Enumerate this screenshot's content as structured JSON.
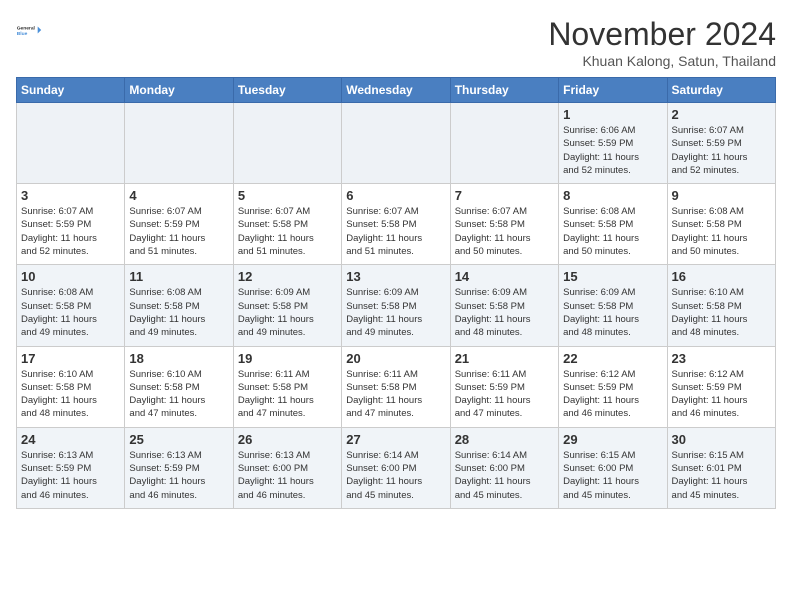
{
  "logo": {
    "line1": "General",
    "line2": "Blue"
  },
  "title": "November 2024",
  "location": "Khuan Kalong, Satun, Thailand",
  "weekdays": [
    "Sunday",
    "Monday",
    "Tuesday",
    "Wednesday",
    "Thursday",
    "Friday",
    "Saturday"
  ],
  "weeks": [
    [
      {
        "day": "",
        "info": ""
      },
      {
        "day": "",
        "info": ""
      },
      {
        "day": "",
        "info": ""
      },
      {
        "day": "",
        "info": ""
      },
      {
        "day": "",
        "info": ""
      },
      {
        "day": "1",
        "info": "Sunrise: 6:06 AM\nSunset: 5:59 PM\nDaylight: 11 hours\nand 52 minutes."
      },
      {
        "day": "2",
        "info": "Sunrise: 6:07 AM\nSunset: 5:59 PM\nDaylight: 11 hours\nand 52 minutes."
      }
    ],
    [
      {
        "day": "3",
        "info": "Sunrise: 6:07 AM\nSunset: 5:59 PM\nDaylight: 11 hours\nand 52 minutes."
      },
      {
        "day": "4",
        "info": "Sunrise: 6:07 AM\nSunset: 5:59 PM\nDaylight: 11 hours\nand 51 minutes."
      },
      {
        "day": "5",
        "info": "Sunrise: 6:07 AM\nSunset: 5:58 PM\nDaylight: 11 hours\nand 51 minutes."
      },
      {
        "day": "6",
        "info": "Sunrise: 6:07 AM\nSunset: 5:58 PM\nDaylight: 11 hours\nand 51 minutes."
      },
      {
        "day": "7",
        "info": "Sunrise: 6:07 AM\nSunset: 5:58 PM\nDaylight: 11 hours\nand 50 minutes."
      },
      {
        "day": "8",
        "info": "Sunrise: 6:08 AM\nSunset: 5:58 PM\nDaylight: 11 hours\nand 50 minutes."
      },
      {
        "day": "9",
        "info": "Sunrise: 6:08 AM\nSunset: 5:58 PM\nDaylight: 11 hours\nand 50 minutes."
      }
    ],
    [
      {
        "day": "10",
        "info": "Sunrise: 6:08 AM\nSunset: 5:58 PM\nDaylight: 11 hours\nand 49 minutes."
      },
      {
        "day": "11",
        "info": "Sunrise: 6:08 AM\nSunset: 5:58 PM\nDaylight: 11 hours\nand 49 minutes."
      },
      {
        "day": "12",
        "info": "Sunrise: 6:09 AM\nSunset: 5:58 PM\nDaylight: 11 hours\nand 49 minutes."
      },
      {
        "day": "13",
        "info": "Sunrise: 6:09 AM\nSunset: 5:58 PM\nDaylight: 11 hours\nand 49 minutes."
      },
      {
        "day": "14",
        "info": "Sunrise: 6:09 AM\nSunset: 5:58 PM\nDaylight: 11 hours\nand 48 minutes."
      },
      {
        "day": "15",
        "info": "Sunrise: 6:09 AM\nSunset: 5:58 PM\nDaylight: 11 hours\nand 48 minutes."
      },
      {
        "day": "16",
        "info": "Sunrise: 6:10 AM\nSunset: 5:58 PM\nDaylight: 11 hours\nand 48 minutes."
      }
    ],
    [
      {
        "day": "17",
        "info": "Sunrise: 6:10 AM\nSunset: 5:58 PM\nDaylight: 11 hours\nand 48 minutes."
      },
      {
        "day": "18",
        "info": "Sunrise: 6:10 AM\nSunset: 5:58 PM\nDaylight: 11 hours\nand 47 minutes."
      },
      {
        "day": "19",
        "info": "Sunrise: 6:11 AM\nSunset: 5:58 PM\nDaylight: 11 hours\nand 47 minutes."
      },
      {
        "day": "20",
        "info": "Sunrise: 6:11 AM\nSunset: 5:58 PM\nDaylight: 11 hours\nand 47 minutes."
      },
      {
        "day": "21",
        "info": "Sunrise: 6:11 AM\nSunset: 5:59 PM\nDaylight: 11 hours\nand 47 minutes."
      },
      {
        "day": "22",
        "info": "Sunrise: 6:12 AM\nSunset: 5:59 PM\nDaylight: 11 hours\nand 46 minutes."
      },
      {
        "day": "23",
        "info": "Sunrise: 6:12 AM\nSunset: 5:59 PM\nDaylight: 11 hours\nand 46 minutes."
      }
    ],
    [
      {
        "day": "24",
        "info": "Sunrise: 6:13 AM\nSunset: 5:59 PM\nDaylight: 11 hours\nand 46 minutes."
      },
      {
        "day": "25",
        "info": "Sunrise: 6:13 AM\nSunset: 5:59 PM\nDaylight: 11 hours\nand 46 minutes."
      },
      {
        "day": "26",
        "info": "Sunrise: 6:13 AM\nSunset: 6:00 PM\nDaylight: 11 hours\nand 46 minutes."
      },
      {
        "day": "27",
        "info": "Sunrise: 6:14 AM\nSunset: 6:00 PM\nDaylight: 11 hours\nand 45 minutes."
      },
      {
        "day": "28",
        "info": "Sunrise: 6:14 AM\nSunset: 6:00 PM\nDaylight: 11 hours\nand 45 minutes."
      },
      {
        "day": "29",
        "info": "Sunrise: 6:15 AM\nSunset: 6:00 PM\nDaylight: 11 hours\nand 45 minutes."
      },
      {
        "day": "30",
        "info": "Sunrise: 6:15 AM\nSunset: 6:01 PM\nDaylight: 11 hours\nand 45 minutes."
      }
    ]
  ]
}
